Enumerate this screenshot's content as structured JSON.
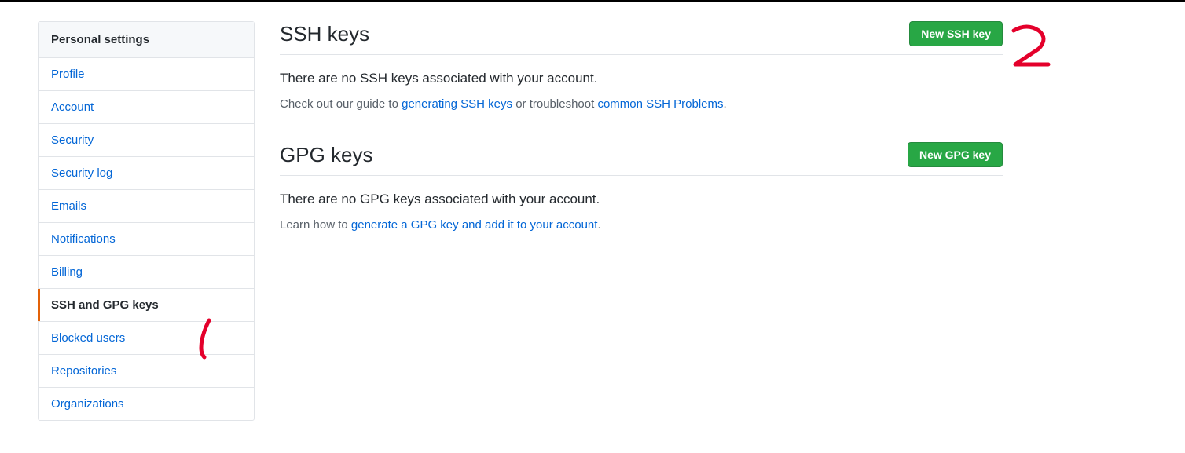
{
  "sidebar": {
    "header": "Personal settings",
    "items": [
      {
        "label": "Profile"
      },
      {
        "label": "Account"
      },
      {
        "label": "Security"
      },
      {
        "label": "Security log"
      },
      {
        "label": "Emails"
      },
      {
        "label": "Notifications"
      },
      {
        "label": "Billing"
      },
      {
        "label": "SSH and GPG keys"
      },
      {
        "label": "Blocked users"
      },
      {
        "label": "Repositories"
      },
      {
        "label": "Organizations"
      }
    ]
  },
  "ssh": {
    "title": "SSH keys",
    "button": "New SSH key",
    "empty": "There are no SSH keys associated with your account.",
    "help_prefix": "Check out our guide to ",
    "help_link1": "generating SSH keys",
    "help_mid": " or troubleshoot ",
    "help_link2": "common SSH Problems",
    "help_suffix": "."
  },
  "gpg": {
    "title": "GPG keys",
    "button": "New GPG key",
    "empty": "There are no GPG keys associated with your account.",
    "help_prefix": "Learn how to ",
    "help_link": "generate a GPG key and add it to your account",
    "help_suffix": "."
  }
}
